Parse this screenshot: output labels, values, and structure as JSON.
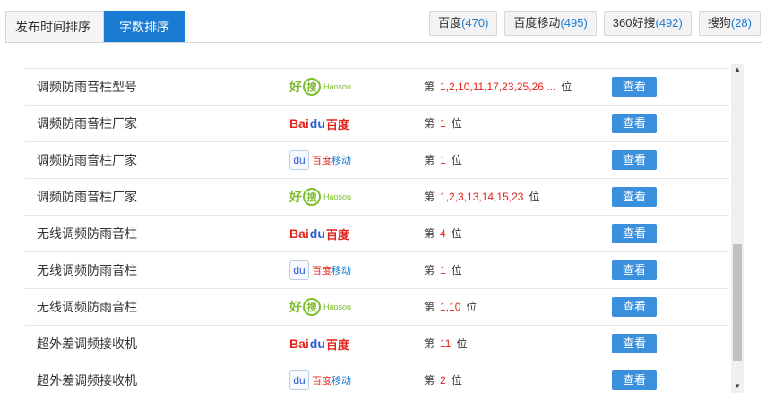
{
  "tabs": [
    {
      "label": "发布时间排序",
      "active": false
    },
    {
      "label": "字数排序",
      "active": true
    }
  ],
  "engines": [
    {
      "name": "百度",
      "count": "(470)"
    },
    {
      "name": "百度移动",
      "count": "(495)"
    },
    {
      "name": "360好搜",
      "count": "(492)"
    },
    {
      "name": "搜狗",
      "count": "(28)"
    }
  ],
  "rank_prefix": "第",
  "rank_suffix": "位",
  "view_label": "查看",
  "logos": {
    "haosou": {
      "hao": "好",
      "sou": "搜",
      "en": "Haosou"
    },
    "baidu": {
      "bai": "Bai",
      "paw": "du",
      "cn": "百度"
    },
    "baidu_mobile": {
      "box": "du",
      "cn1": "百度",
      "cn2": "移动"
    }
  },
  "rows": [
    {
      "keyword": "调频防雨音柱型号",
      "engine": "haosou",
      "rank": "1,2,10,11,17,23,25,26 ..."
    },
    {
      "keyword": "调频防雨音柱厂家",
      "engine": "baidu",
      "rank": "1"
    },
    {
      "keyword": "调频防雨音柱厂家",
      "engine": "baidu_mobile",
      "rank": "1"
    },
    {
      "keyword": "调频防雨音柱厂家",
      "engine": "haosou",
      "rank": "1,2,3,13,14,15,23"
    },
    {
      "keyword": "无线调频防雨音柱",
      "engine": "baidu",
      "rank": "4"
    },
    {
      "keyword": "无线调频防雨音柱",
      "engine": "baidu_mobile",
      "rank": "1"
    },
    {
      "keyword": "无线调频防雨音柱",
      "engine": "haosou",
      "rank": "1,10"
    },
    {
      "keyword": "超外差调频接收机",
      "engine": "baidu",
      "rank": "11"
    },
    {
      "keyword": "超外差调频接收机",
      "engine": "baidu_mobile",
      "rank": "2"
    }
  ],
  "colors": {
    "accent": "#1a7bd3",
    "rank_number": "#e2231a",
    "view_button": "#3a90dd"
  }
}
